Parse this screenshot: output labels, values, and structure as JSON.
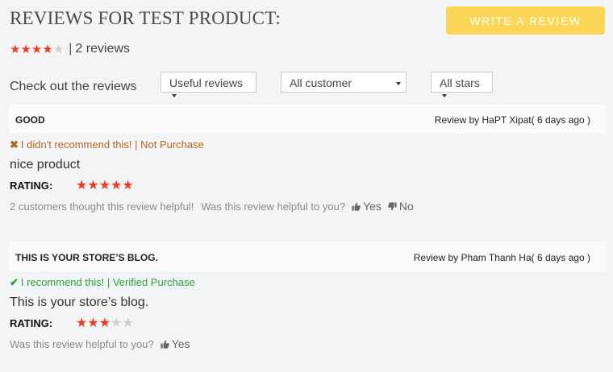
{
  "header": {
    "title": "REVIEWS FOR TEST PRODUCT:",
    "write_button": "WRITE A REVIEW"
  },
  "summary": {
    "average_stars": 4,
    "max_stars": 5,
    "separator": "|",
    "count_text": "2 reviews"
  },
  "filters": {
    "label": "Check out the reviews",
    "sort": "Useful reviews",
    "customer": "All customer",
    "stars": "All stars"
  },
  "colors": {
    "accent_button": "#fcd757",
    "star_on": "#ee3a1f",
    "star_off": "#cfcfcf",
    "not_recommend": "#b5661c",
    "recommend": "#2e9e3e"
  },
  "reviews": [
    {
      "title": "GOOD",
      "by": "Review by HaPT Xipat( 6 days ago )",
      "recommend_icon": "x-icon",
      "recommend_text": "I didn't recommend this! | Not Purchase",
      "body": "nice product",
      "rating_label": "RATING:",
      "rating": 5,
      "helpful_count_text": "2 customers thought this review helpful!",
      "helpful_question": "Was this review helpful to you?",
      "yes_label": "Yes",
      "no_label": "No"
    },
    {
      "title": "THIS IS YOUR STORE’S BLOG.",
      "by": "Review by Pham Thanh Ha( 6 days ago )",
      "recommend_icon": "check-icon",
      "recommend_text": "I recommend this! | Verified Purchase",
      "body": "This is your store’s blog.",
      "rating_label": "RATING:",
      "rating": 3,
      "helpful_question": "Was this review helpful to you?",
      "yes_label": "Yes"
    }
  ]
}
